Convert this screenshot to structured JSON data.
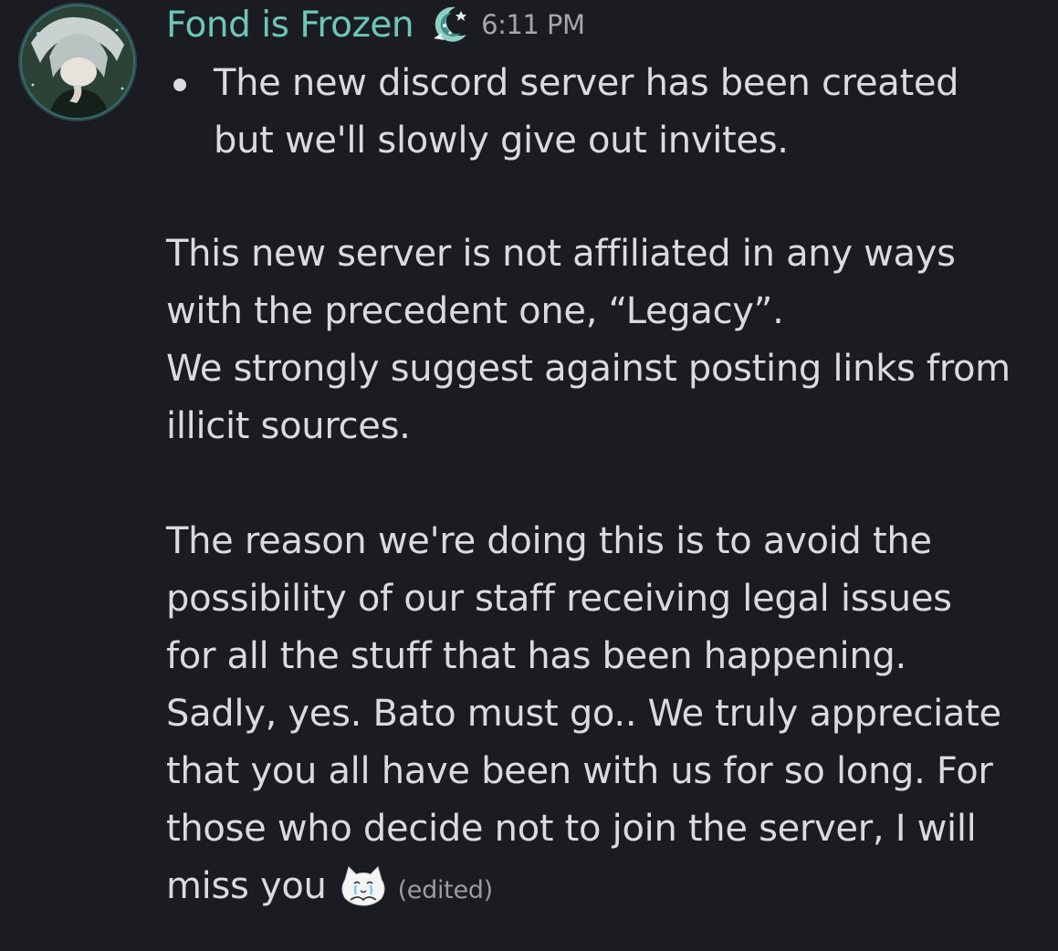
{
  "message": {
    "avatar_icon": "user-avatar",
    "username": "Fond is Frozen",
    "role_icon": "moon-badge-icon",
    "timestamp": "6:11 PM",
    "bullet": {
      "lines": [
        "The new discord server has been created",
        "but we'll slowly give out invites."
      ]
    },
    "paragraph1": {
      "lines": [
        "This new server is not affiliated in any ways",
        "with the precedent one, “Legacy”.",
        "We strongly suggest against posting links from",
        "illicit sources."
      ]
    },
    "paragraph2": {
      "lines": [
        "The reason we're doing this is to avoid the",
        "possibility of our staff receiving legal issues",
        "for all the stuff that has been happening.",
        "Sadly, yes. Bato must go.. We truly appreciate",
        "that you all have been with us for so long. For",
        "those who decide not to join the server, I will",
        "miss you"
      ]
    },
    "emoji_icon": "crying-cat-emoji",
    "edited_label": "(edited)"
  },
  "colors": {
    "background": "#1b1c21",
    "username": "#6ec6b8",
    "text": "#dadbdf",
    "muted": "#a3a6ad"
  }
}
